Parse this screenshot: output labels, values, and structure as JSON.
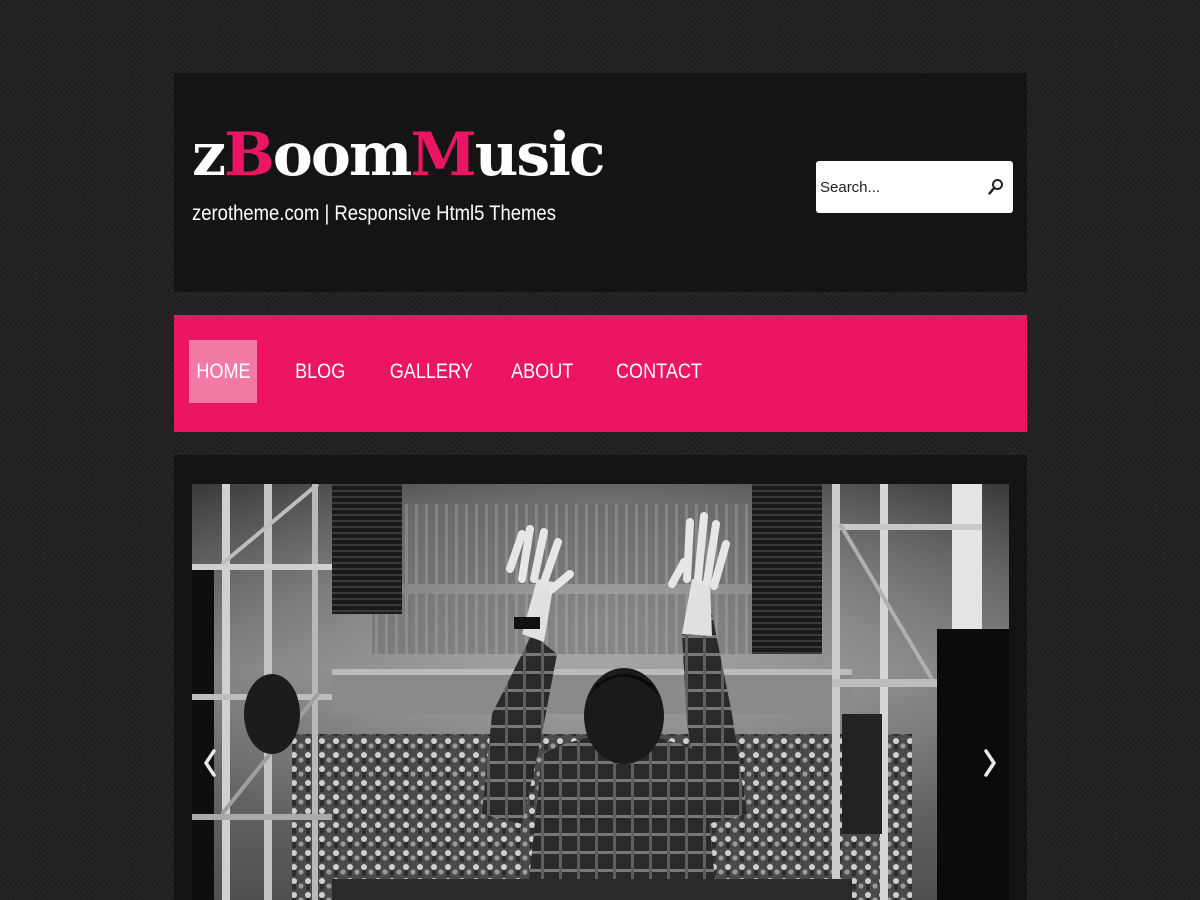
{
  "brand": {
    "logo_parts": [
      "z",
      "B",
      "oom",
      "M",
      "usic"
    ],
    "tagline": "zerotheme.com | Responsive Html5 Themes",
    "accent_color": "#ec1563"
  },
  "search": {
    "placeholder": "Search...",
    "icon": "search-icon"
  },
  "nav": {
    "items": [
      {
        "label": "HOME",
        "active": true
      },
      {
        "label": "BLOG",
        "active": false
      },
      {
        "label": "GALLERY",
        "active": false
      },
      {
        "label": "ABOUT",
        "active": false
      },
      {
        "label": "CONTACT",
        "active": false
      }
    ]
  },
  "slider": {
    "prev_icon": "chevron-left-icon",
    "next_icon": "chevron-right-icon"
  },
  "colors": {
    "background": "#232323",
    "panel": "#141414",
    "nav_background": "#ec1563",
    "nav_active": "#f37aa4",
    "text": "#ffffff"
  }
}
